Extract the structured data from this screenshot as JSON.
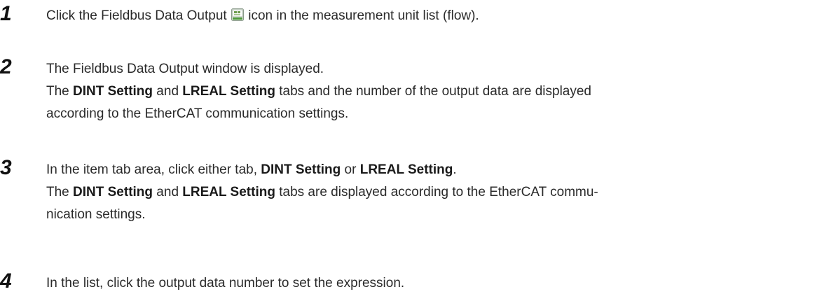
{
  "steps": [
    {
      "number": "1",
      "before_icon": "Click the Fieldbus Data Output ",
      "icon": "fieldbus-data-output-icon",
      "after_icon": " icon in the measurement unit list (flow)."
    },
    {
      "number": "2",
      "line1": "The Fieldbus Data Output window is displayed.",
      "line2_a": "The ",
      "line2_b": "DINT Setting",
      "line2_c": " and ",
      "line2_d": "LREAL Setting",
      "line2_e": " tabs and the number of the output data are displayed",
      "line3": "according to the EtherCAT communication settings."
    },
    {
      "number": "3",
      "line1_a": "In the item tab area, click either tab, ",
      "line1_b": "DINT Setting",
      "line1_c": " or ",
      "line1_d": "LREAL Setting",
      "line1_e": ".",
      "line2_a": "The ",
      "line2_b": "DINT Setting",
      "line2_c": " and ",
      "line2_d": "LREAL Setting",
      "line2_e": " tabs are displayed according to the EtherCAT commu-",
      "line3": "nication settings."
    },
    {
      "number": "4",
      "line1": "In the list, click the output data number to set the expression."
    }
  ]
}
